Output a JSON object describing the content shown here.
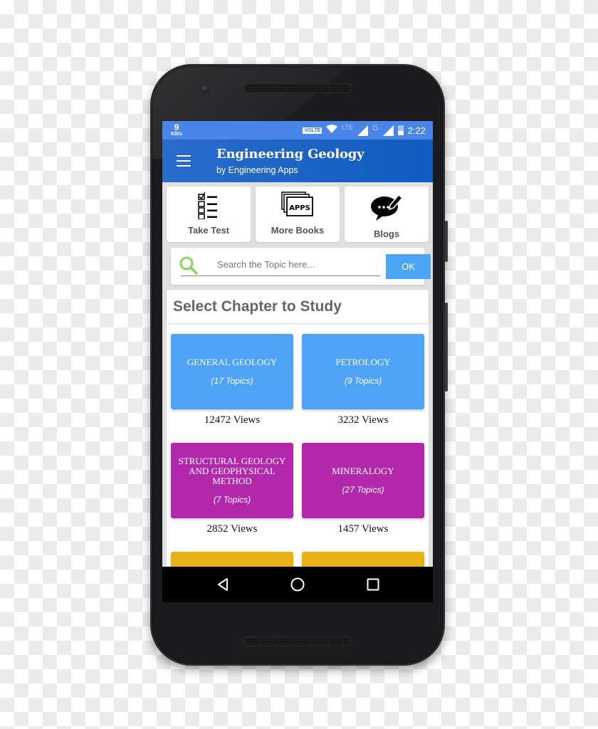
{
  "status_bar": {
    "net_speed_value": "9",
    "net_speed_unit": "KB/s",
    "volte_label": "VOLTE",
    "lte_label": "LTE",
    "g_label": "G",
    "time": "2:22"
  },
  "app_bar": {
    "title": "Engineering Geology",
    "subtitle": "by Engineering Apps",
    "menu_icon": "hamburger-menu-icon"
  },
  "shortcuts": [
    {
      "label": "Take Test",
      "icon": "checklist-icon"
    },
    {
      "label": "More Books",
      "icon": "apps-stack-icon",
      "icon_text": "APPS"
    },
    {
      "label": "Blogs",
      "icon": "chat-bubble-pencil-icon"
    }
  ],
  "search": {
    "placeholder": "Search the Topic here...",
    "value": "",
    "button_label": "OK",
    "icon": "search-icon"
  },
  "chapters_section": {
    "title": "Select Chapter to Study",
    "chapters": [
      {
        "name": "GENERAL GEOLOGY",
        "topics": "(17 Topics)",
        "views": "12472 Views",
        "color": "#4fa3f7"
      },
      {
        "name": "PETROLOGY",
        "topics": "(9 Topics)",
        "views": "3232 Views",
        "color": "#4fa3f7"
      },
      {
        "name": "STRUCTURAL GEOLOGY AND GEOPHYSICAL METHOD",
        "topics": "(7 Topics)",
        "views": "2852 Views",
        "color": "#b228ab"
      },
      {
        "name": "MINERALOGY",
        "topics": "(27 Topics)",
        "views": "1457 Views",
        "color": "#b228ab"
      },
      {
        "name": "",
        "topics": "",
        "views": "",
        "color": "#e8b117"
      },
      {
        "name": "",
        "topics": "",
        "views": "",
        "color": "#e8b117"
      }
    ]
  },
  "nav_bar": {
    "back_icon": "back-triangle-icon",
    "home_icon": "home-circle-icon",
    "recent_icon": "recent-apps-square-icon"
  },
  "colors": {
    "status_bar": "#4a86e8",
    "app_bar": "#1a62c4",
    "ok_button": "#4da6f5",
    "search_icon": "#7ed957",
    "tile_blue": "#4fa3f7",
    "tile_purple": "#b228ab",
    "tile_yellow": "#e8b117"
  }
}
